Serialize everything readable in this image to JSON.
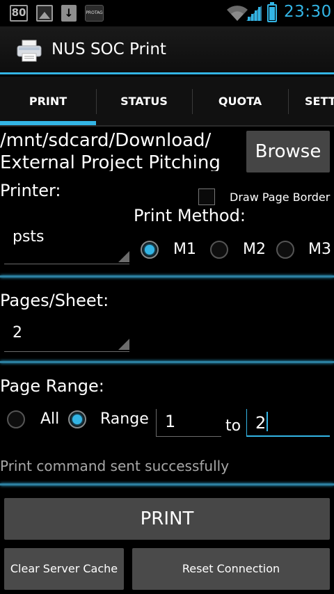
{
  "status_bar": {
    "battery_number": "80",
    "protag_label": "PROTAG",
    "time": "23:30",
    "battery_level": 0.85,
    "accent": "#33b5e5"
  },
  "action_bar": {
    "title": "NUS SOC Print",
    "icon": "printer-icon"
  },
  "tabs": [
    {
      "label": "PRINT",
      "selected": true
    },
    {
      "label": "STATUS",
      "selected": false
    },
    {
      "label": "QUOTA",
      "selected": false
    },
    {
      "label": "SETT",
      "selected": false
    }
  ],
  "file": {
    "path": "/mnt/sdcard/Download/\nExternal Project Pitching",
    "browse_label": "Browse"
  },
  "printer": {
    "label": "Printer:",
    "selected": "psts"
  },
  "draw_page_border": {
    "label": "Draw Page Border",
    "checked": false
  },
  "print_method": {
    "label": "Print Method:",
    "options": [
      "M1",
      "M2",
      "M3"
    ],
    "selected": "M1"
  },
  "pages_per_sheet": {
    "label": "Pages/Sheet:",
    "selected": "2"
  },
  "page_range": {
    "label": "Page Range:",
    "all_label": "All",
    "range_label": "Range",
    "selected": "Range",
    "from": "1",
    "to_label": "to",
    "to": "2"
  },
  "status_message": "Print command sent successfully",
  "buttons": {
    "print": "PRINT",
    "clear_cache": "Clear Server Cache",
    "reset_connection": "Reset Connection"
  }
}
